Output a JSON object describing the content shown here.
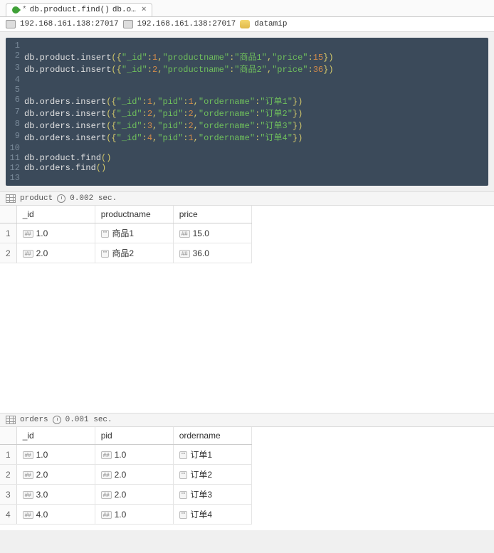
{
  "tabs": {
    "tab1_prefix": "*",
    "tab1_title": "db.product.find()",
    "tab2_title": "db.o…"
  },
  "breadcrumb": {
    "server1": "192.168.161.138:27017",
    "server2": "192.168.161.138:27017",
    "database": "datamip"
  },
  "code": {
    "lines": [
      {
        "n": "1",
        "plain": ""
      },
      {
        "n": "2",
        "obj": "db.product.insert",
        "str1": "\"_id\"",
        "num1": "1",
        "str2": "\"productname\"",
        "str3": "\"商品1\"",
        "str4": "\"price\"",
        "num2": "15"
      },
      {
        "n": "3",
        "obj": "db.product.insert",
        "str1": "\"_id\"",
        "num1": "2",
        "str2": "\"productname\"",
        "str3": "\"商品2\"",
        "str4": "\"price\"",
        "num2": "36"
      },
      {
        "n": "4",
        "plain": ""
      },
      {
        "n": "5",
        "plain": ""
      },
      {
        "n": "6",
        "obj": "db.orders.insert",
        "str1": "\"_id\"",
        "num1": "1",
        "str2": "\"pid\"",
        "num2": "1",
        "str3": "\"ordername\"",
        "str4": "\"订单1\""
      },
      {
        "n": "7",
        "obj": "db.orders.insert",
        "str1": "\"_id\"",
        "num1": "2",
        "str2": "\"pid\"",
        "num2": "2",
        "str3": "\"ordername\"",
        "str4": "\"订单2\""
      },
      {
        "n": "8",
        "obj": "db.orders.insert",
        "str1": "\"_id\"",
        "num1": "3",
        "str2": "\"pid\"",
        "num2": "2",
        "str3": "\"ordername\"",
        "str4": "\"订单3\""
      },
      {
        "n": "9",
        "obj": "db.orders.insert",
        "str1": "\"_id\"",
        "num1": "4",
        "str2": "\"pid\"",
        "num2": "1",
        "str3": "\"ordername\"",
        "str4": "\"订单4\""
      },
      {
        "n": "10",
        "plain": ""
      },
      {
        "n": "11",
        "obj": "db.product.find",
        "empty": true
      },
      {
        "n": "12",
        "obj": "db.orders.find",
        "empty": true
      },
      {
        "n": "13",
        "plain": ""
      }
    ]
  },
  "result1": {
    "label": "product",
    "time": "0.002 sec.",
    "headers": [
      "_id",
      "productname",
      "price"
    ],
    "type_tags": {
      "num": "##",
      "str": "\"\""
    },
    "rows": [
      {
        "n": "1",
        "c": [
          {
            "t": "##",
            "v": "1.0"
          },
          {
            "t": "\"\"",
            "v": "商品1"
          },
          {
            "t": "##",
            "v": "15.0"
          }
        ]
      },
      {
        "n": "2",
        "c": [
          {
            "t": "##",
            "v": "2.0"
          },
          {
            "t": "\"\"",
            "v": "商品2"
          },
          {
            "t": "##",
            "v": "36.0"
          }
        ]
      }
    ]
  },
  "result2": {
    "label": "orders",
    "time": "0.001 sec.",
    "headers": [
      "_id",
      "pid",
      "ordername"
    ],
    "rows": [
      {
        "n": "1",
        "c": [
          {
            "t": "##",
            "v": "1.0"
          },
          {
            "t": "##",
            "v": "1.0"
          },
          {
            "t": "\"\"",
            "v": "订单1"
          }
        ]
      },
      {
        "n": "2",
        "c": [
          {
            "t": "##",
            "v": "2.0"
          },
          {
            "t": "##",
            "v": "2.0"
          },
          {
            "t": "\"\"",
            "v": "订单2"
          }
        ]
      },
      {
        "n": "3",
        "c": [
          {
            "t": "##",
            "v": "3.0"
          },
          {
            "t": "##",
            "v": "2.0"
          },
          {
            "t": "\"\"",
            "v": "订单3"
          }
        ]
      },
      {
        "n": "4",
        "c": [
          {
            "t": "##",
            "v": "4.0"
          },
          {
            "t": "##",
            "v": "1.0"
          },
          {
            "t": "\"\"",
            "v": "订单4"
          }
        ]
      }
    ]
  },
  "chart_data": [
    {
      "type": "table",
      "title": "product",
      "columns": [
        "_id",
        "productname",
        "price"
      ],
      "rows": [
        [
          1.0,
          "商品1",
          15.0
        ],
        [
          2.0,
          "商品2",
          36.0
        ]
      ]
    },
    {
      "type": "table",
      "title": "orders",
      "columns": [
        "_id",
        "pid",
        "ordername"
      ],
      "rows": [
        [
          1.0,
          1.0,
          "订单1"
        ],
        [
          2.0,
          2.0,
          "订单2"
        ],
        [
          3.0,
          2.0,
          "订单3"
        ],
        [
          4.0,
          1.0,
          "订单4"
        ]
      ]
    }
  ]
}
